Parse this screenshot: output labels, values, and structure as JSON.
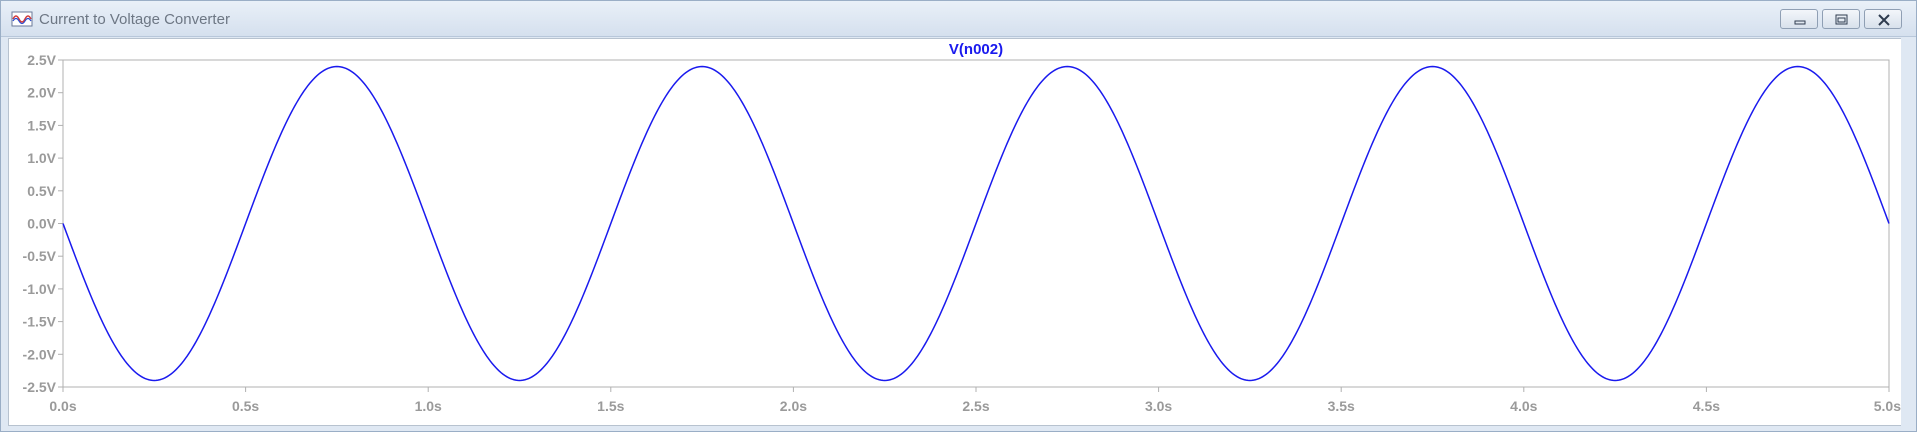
{
  "window": {
    "title": "Current to Voltage Converter",
    "icon": "waveform-viewer-icon",
    "controls": {
      "minimize_icon": "minimize-icon",
      "restore_icon": "restore-icon",
      "close_icon": "close-icon"
    }
  },
  "colors": {
    "trace": "#1a1aee",
    "axis_text": "#9a9a9a",
    "frame": "#b0b0b0"
  },
  "chart_data": {
    "type": "line",
    "title": "V(n002)",
    "xlabel": "",
    "ylabel": "",
    "xlim": [
      0,
      5
    ],
    "ylim": [
      -2.5,
      2.5
    ],
    "x_ticks": [
      "0.0s",
      "0.5s",
      "1.0s",
      "1.5s",
      "2.0s",
      "2.5s",
      "3.0s",
      "3.5s",
      "4.0s",
      "4.5s",
      "5.0s"
    ],
    "y_ticks": [
      "2.5V",
      "2.0V",
      "1.5V",
      "1.0V",
      "0.5V",
      "0.0V",
      "-0.5V",
      "-1.0V",
      "-1.5V",
      "-2.0V",
      "-2.5V"
    ],
    "grid": false,
    "series": [
      {
        "name": "V(n002)",
        "amplitude": 2.4,
        "frequency_hz": 1,
        "phase": "inverted sine",
        "x": [
          0,
          0.125,
          0.25,
          0.375,
          0.5,
          0.625,
          0.75,
          0.875,
          1.0,
          1.125,
          1.25,
          1.375,
          1.5,
          1.625,
          1.75,
          1.875,
          2.0,
          2.125,
          2.25,
          2.375,
          2.5,
          2.625,
          2.75,
          2.875,
          3.0,
          3.125,
          3.25,
          3.375,
          3.5,
          3.625,
          3.75,
          3.875,
          4.0,
          4.125,
          4.25,
          4.375,
          4.5,
          4.625,
          4.75,
          4.875,
          5.0
        ],
        "y": [
          0,
          -1.7,
          -2.4,
          -1.7,
          0,
          1.7,
          2.4,
          1.7,
          0,
          -1.7,
          -2.4,
          -1.7,
          0,
          1.7,
          2.4,
          1.7,
          0,
          -1.7,
          -2.4,
          -1.7,
          0,
          1.7,
          2.4,
          1.7,
          0,
          -1.7,
          -2.4,
          -1.7,
          0,
          1.7,
          2.4,
          1.7,
          0,
          -1.7,
          -2.4,
          -1.7,
          0,
          1.7,
          2.4,
          1.7,
          0
        ]
      }
    ]
  }
}
